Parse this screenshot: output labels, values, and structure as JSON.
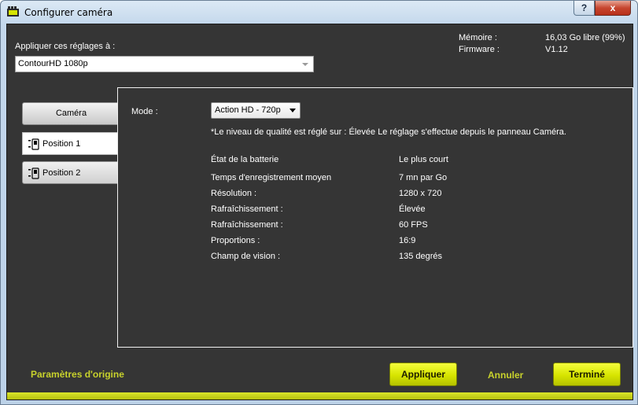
{
  "window": {
    "title": "Configurer caméra",
    "help_label": "?",
    "close_label": "x"
  },
  "apply_to": {
    "label": "Appliquer ces réglages à :",
    "selected_device": "ContourHD 1080p"
  },
  "info": {
    "memory_label": "Mémoire :",
    "memory_value": "16,03 Go libre (99%)",
    "firmware_label": "Firmware :",
    "firmware_value": "V1.12"
  },
  "tabs": [
    {
      "label": "Caméra"
    },
    {
      "label": "Position 1"
    },
    {
      "label": "Position 2"
    }
  ],
  "settings": {
    "mode_label": "Mode :",
    "mode_value": "Action HD - 720p",
    "quality_note": "*Le niveau de qualité est réglé sur : Élevée  Le réglage s'effectue depuis le panneau Caméra.",
    "rows": [
      {
        "label": "État de la batterie",
        "value": "Le plus court"
      },
      {
        "label": "Temps d'enregistrement moyen",
        "value": "7 mn par Go"
      },
      {
        "label": "Résolution :",
        "value": "1280 x 720"
      },
      {
        "label": "Rafraîchissement :",
        "value": "Élevée"
      },
      {
        "label": "Rafraîchissement :",
        "value": "60 FPS"
      },
      {
        "label": "Proportions :",
        "value": "16:9"
      },
      {
        "label": "Champ de vision :",
        "value": "135 degrés"
      }
    ]
  },
  "footer": {
    "reset_label": "Paramètres d'origine",
    "apply_label": "Appliquer",
    "cancel_label": "Annuler",
    "done_label": "Terminé"
  },
  "colors": {
    "accent": "#d6e400",
    "link": "#c8d22c",
    "background": "#353535"
  }
}
